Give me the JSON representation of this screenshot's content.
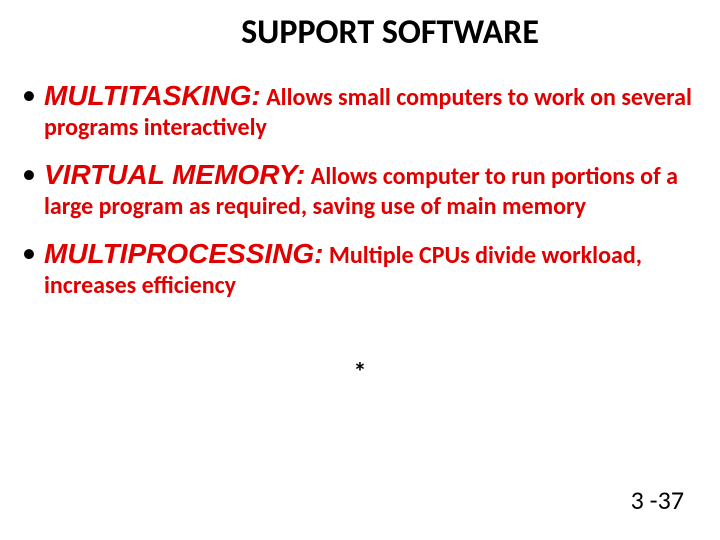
{
  "title": "SUPPORT SOFTWARE",
  "bullets": [
    {
      "term": "MULTITASKING:",
      "desc": " Allows small computers to work on several programs interactively"
    },
    {
      "term": "VIRTUAL MEMORY:",
      "desc": " Allows computer to run portions of a large program as required, saving use of main memory"
    },
    {
      "term": "MULTIPROCESSING:",
      "desc": " Multiple CPUs divide workload, increases efficiency"
    }
  ],
  "asterisk": "*",
  "pagenum": "3 -37"
}
